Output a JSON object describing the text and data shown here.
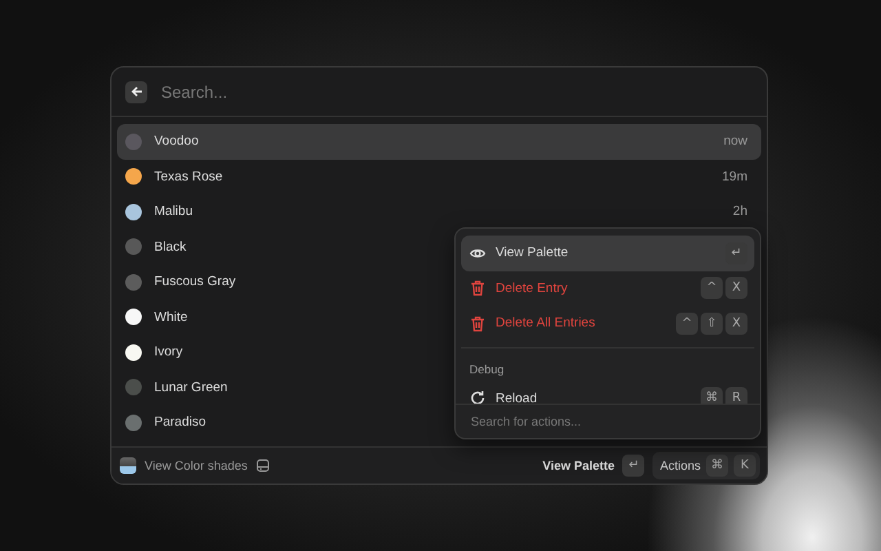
{
  "search": {
    "placeholder": "Search..."
  },
  "items": [
    {
      "name": "Voodoo",
      "color": "#5a575e",
      "time": "now",
      "selected": true
    },
    {
      "name": "Texas Rose",
      "color": "#f5a64b",
      "time": "19m",
      "selected": false
    },
    {
      "name": "Malibu",
      "color": "#a9c5dd",
      "time": "2h",
      "selected": false
    },
    {
      "name": "Black",
      "color": "#585858",
      "selected": false
    },
    {
      "name": "Fuscous Gray",
      "color": "#5c5c5c",
      "selected": false
    },
    {
      "name": "White",
      "color": "#f7f7f7",
      "selected": false
    },
    {
      "name": "Ivory",
      "color": "#f8f8f2",
      "selected": false
    },
    {
      "name": "Lunar Green",
      "color": "#4b4e4b",
      "selected": false
    },
    {
      "name": "Paradiso",
      "color": "#6a6f6f",
      "selected": false
    }
  ],
  "footer": {
    "title": "View Color shades",
    "primary_action": "View Palette",
    "primary_key": "↵",
    "actions_label": "Actions",
    "actions_keys": [
      "⌘",
      "K"
    ]
  },
  "actions_menu": {
    "sections": [
      {
        "items": [
          {
            "label": "View Palette",
            "kind": "eye",
            "destructive": false,
            "selected": true,
            "keys": [
              "↵"
            ]
          },
          {
            "label": "Delete Entry",
            "kind": "trash",
            "destructive": true,
            "selected": false,
            "keys": [
              "^",
              "X"
            ]
          },
          {
            "label": "Delete All Entries",
            "kind": "trash",
            "destructive": true,
            "selected": false,
            "keys": [
              "^",
              "⇧",
              "X"
            ]
          }
        ]
      },
      {
        "title": "Debug",
        "items": [
          {
            "label": "Reload",
            "kind": "reload",
            "destructive": false,
            "selected": false,
            "keys": [
              "⌘",
              "R"
            ]
          }
        ]
      }
    ],
    "search_placeholder": "Search for actions..."
  }
}
